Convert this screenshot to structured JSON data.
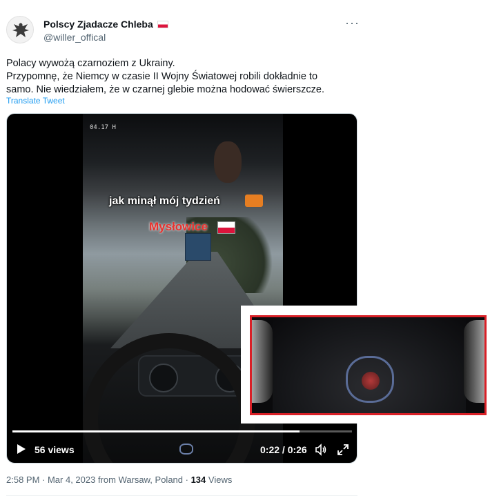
{
  "author": {
    "display_name": "Polscy Zjadacze Chleba",
    "handle": "@willer_offical",
    "flag_icon": "poland-flag-icon"
  },
  "tweet": {
    "lines": [
      "Polacy wywożą czarnoziem z Ukrainy.",
      "Przypomnę, że Niemcy w czasie II Wojny Światowej robili dokładnie to",
      "samo. Nie wiedziałem, że w czarnej glebie można hodować świerszcze."
    ],
    "translate_label": "Translate Tweet"
  },
  "video": {
    "caption_line1": "jak minął mój tydzień",
    "caption_line2": "Mysłowice",
    "odometer": "04.17 H",
    "views_label": "56 views",
    "time_label": "0:22 / 0:26",
    "progress_fraction": 0.846
  },
  "meta": {
    "time_location": "2:58 PM · Mar 4, 2023 from Warsaw, Poland · ",
    "view_count": "134",
    "views_word": " Views"
  },
  "colors": {
    "accent": "#1d9bf0",
    "highlight_border": "#d92027",
    "secondary_text": "#536471"
  }
}
